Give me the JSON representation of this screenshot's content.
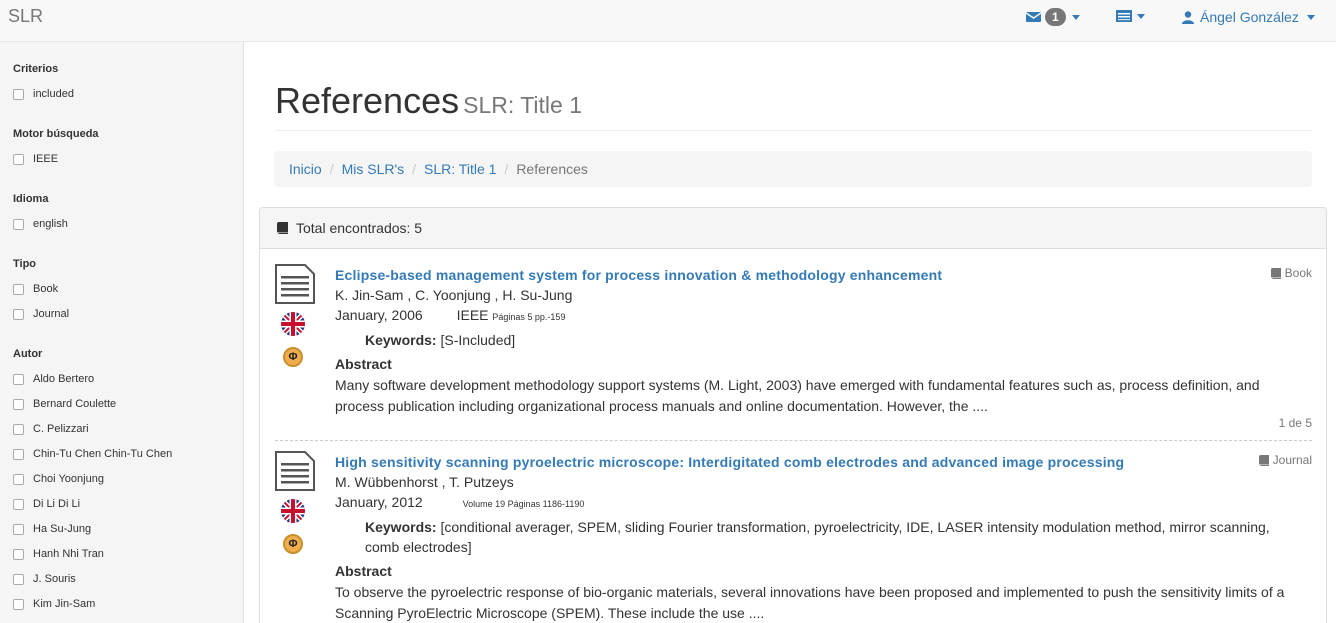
{
  "navbar": {
    "brand": "SLR",
    "mail_count": "1",
    "user_name": "Ángel González"
  },
  "sidebar": {
    "facets": [
      {
        "title": "Criterios",
        "options": [
          "included"
        ]
      },
      {
        "title": "Motor búsqueda",
        "options": [
          "IEEE"
        ]
      },
      {
        "title": "Idioma",
        "options": [
          "english"
        ]
      },
      {
        "title": "Tipo",
        "options": [
          "Book",
          "Journal"
        ]
      },
      {
        "title": "Autor",
        "options": [
          "Aldo Bertero",
          "Bernard Coulette",
          "C. Pelizzari",
          "Chin-Tu Chen Chin-Tu Chen",
          "Choi Yoonjung",
          "Di Li Di Li",
          "Ha Su-Jung",
          "Hanh Nhi Tran",
          "J. Souris",
          "Kim Jin-Sam"
        ]
      }
    ]
  },
  "header": {
    "title": "References",
    "subtitle": "SLR: Title 1"
  },
  "breadcrumb": {
    "items": [
      "Inicio",
      "Mis SLR's",
      "SLR: Title 1"
    ],
    "active": "References"
  },
  "panel": {
    "total_label": "Total encontrados: 5"
  },
  "references": [
    {
      "title": "Eclipse-based management system for process innovation & methodology enhancement",
      "authors": "K. Jin-Sam , C. Yoonjung , H. Su-Jung",
      "date": "January, 2006",
      "source": "IEEE",
      "pages": "Páginas 5 pp.-159",
      "type": "Book",
      "keywords_label": "Keywords:",
      "keywords": "[S-Included]",
      "abstract_label": "Abstract",
      "abstract": "Many software development methodology support systems (M. Light, 2003) have emerged with fundamental features such as, process definition, and process publication including organizational process manuals and online documentation. However, the ....",
      "count": "1 de 5"
    },
    {
      "title": "High sensitivity scanning pyroelectric microscope: Interdigitated comb electrodes and advanced image processing",
      "authors": "M. Wübbenhorst , T. Putzeys",
      "date": "January, 2012",
      "pages": "Volume 19 Páginas 1186-1190",
      "type": "Journal",
      "keywords_label": "Keywords:",
      "keywords": "[conditional averager, SPEM, sliding Fourier transformation, pyroelectricity, IDE, LASER intensity modulation method, mirror scanning, comb electrodes]",
      "abstract_label": "Abstract",
      "abstract": "To observe the pyroelectric response of bio-organic materials, several innovations have been proposed and implemented to push the sensitivity limits of a Scanning PyroElectric Microscope (SPEM). These include the use ...."
    }
  ],
  "icons": {
    "flag": "uk-flag-icon",
    "database": "database-badge-icon"
  }
}
